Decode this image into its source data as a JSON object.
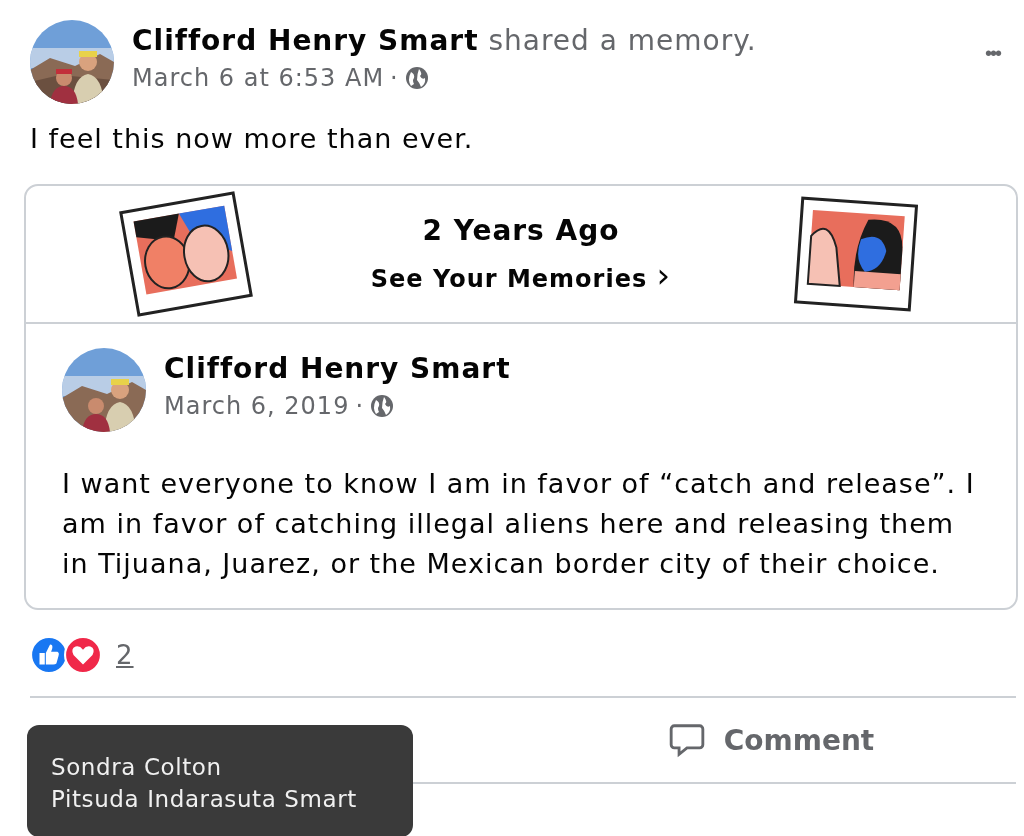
{
  "post": {
    "author": "Clifford Henry Smart",
    "action": "shared a memory.",
    "time": "March 6 at 6:53 AM",
    "separator": "·",
    "more": "•••",
    "text": "I feel this now more than ever."
  },
  "memory": {
    "title": "2 Years Ago",
    "link": "See Your Memories",
    "chevron": "›"
  },
  "original_post": {
    "author": "Clifford Henry Smart",
    "time": "March 6, 2019",
    "separator": "·",
    "text": "I want everyone to know I am in favor of “catch and release”. I am in favor of catching illegal aliens here and releasing them in Tijuana, Juarez, or the Mexican border city of their choice."
  },
  "reactions": {
    "count": "2"
  },
  "actions": [
    {
      "label": "Comment",
      "kind": "comment"
    }
  ],
  "tooltip": {
    "names": [
      "Sondra Colton",
      "Pitsuda Indarasuta Smart"
    ]
  }
}
